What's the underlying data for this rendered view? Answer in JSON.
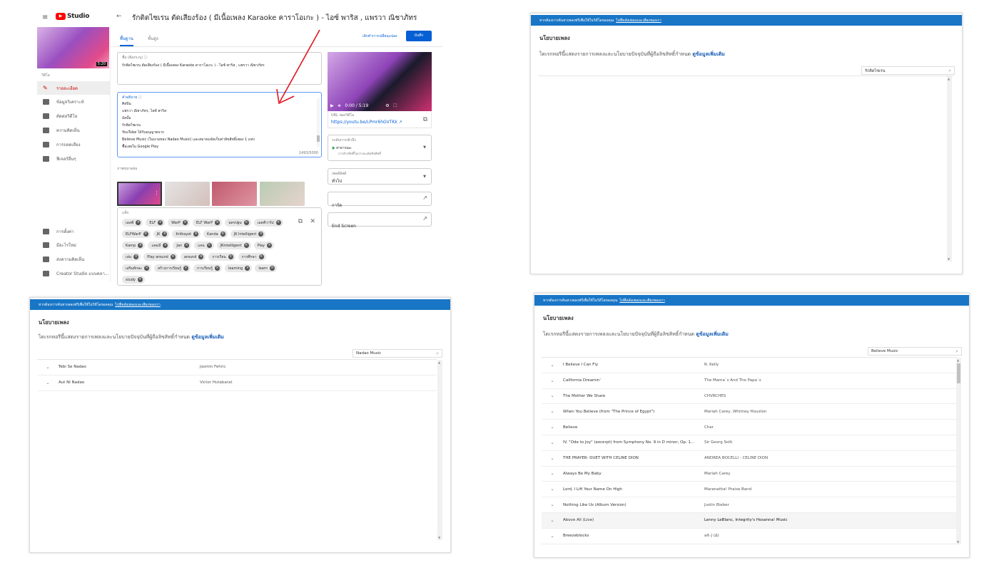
{
  "studio": {
    "logo": "Studio",
    "video_title": "รักติดไซเรน ตัดเสียงร้อง ( มีเนื้อเพลง Karaoke คาราโอเกะ ) - ไอซ์ พาริส , แพรวา ณิชาภัทร",
    "thumb_duration": "5:20",
    "sidebar_section": "วิดีโอ",
    "sidebar": [
      {
        "label": "รายละเอียด",
        "icon": "pencil-icon"
      },
      {
        "label": "ข้อมูลวิเคราะห์",
        "icon": "analytics-icon"
      },
      {
        "label": "ตัดต่อวิดีโอ",
        "icon": "editor-icon"
      },
      {
        "label": "ความคิดเห็น",
        "icon": "comments-icon"
      },
      {
        "label": "การถอดเสียง",
        "icon": "translate-icon"
      },
      {
        "label": "ฟีเจอร์อื่นๆ",
        "icon": "other-features-icon"
      }
    ],
    "sidebar_bottom": [
      {
        "label": "การตั้งค่า",
        "icon": "gear-icon"
      },
      {
        "label": "มีอะไรใหม่",
        "icon": "alert-icon"
      },
      {
        "label": "ส่งความคิดเห็น",
        "icon": "feedback-icon"
      },
      {
        "label": "Creator Studio แบบคลา...",
        "icon": "classic-studio-icon"
      }
    ],
    "tabs": [
      "พื้นฐาน",
      "ขั้นสูง"
    ],
    "undo_label": "เลิกทำการเปลี่ยนแปลง",
    "save_label": "บันทึก",
    "title_label": "ชื่อ (ต้องระบุ)",
    "title_value": "รักติดไซเรน ตัดเสียงร้อง ( มีเนื้อเพลง Karaoke คาราโอเกะ ) - ไอซ์ พาริส , แพรวา ณิชาภัทร",
    "desc_label": "คำอธิบาย",
    "desc_lines": [
      "ศิลปิน",
      "แพรวา ณิชาภัทร, ไอซ์ พาริส",
      "อัลบั้ม",
      "รักติดไซเรน",
      "YouTube ได้รับอนุญาตจาก",
      "Believe Music (ในนามของ Nadao Music) และสมาคมจัดเก็บค่าลิขสิทธิ์เพลง 1 แห่ง",
      "ซื้อเลยใน Google Play"
    ],
    "desc_count": "1493/5000",
    "thumbnails_label": "ภาพขนาดย่อ",
    "tags_label": "แท็ก",
    "tags": [
      "เอลฟ์",
      "ELF",
      "WarP",
      "ELF WarP",
      "นครปฐม",
      "เอลฟ์วาร์ป",
      "ELFWarP",
      "JK",
      "Krittayot",
      "Kanda",
      "JK Intelligent",
      "Kamp",
      "แคมป์",
      "Jan",
      "แจน",
      "JKintelligent",
      "Play",
      "เล่น",
      "Play around",
      "around",
      "การเรียน",
      "การศึกษา",
      "เสริมทักษะ",
      "สร้างการเรียนรู้",
      "การเรียนรู้",
      "learning",
      "learn",
      "study"
    ],
    "player_time": "0:00 / 5:19",
    "url_label": "URL ของวิดีโอ",
    "url": "https://youtu.be/LPmr6hGVTKk",
    "visibility_label": "ระดับการเข้าถึง",
    "visibility_value": "สาธารณะ",
    "visibility_sub": "การอ้างสิทธิ์ในการละเมิดลิขสิทธิ์",
    "playlist_label": "เพลย์ลิสต์",
    "playlist_value": "ทั่วไป",
    "cards_label": "การ์ด",
    "endscreen_label": "End Screen"
  },
  "music_common": {
    "banner_text": "หากต้องการค้นหาเพลงฟรีเพื่อใช้ในวิดีโอของคุณ",
    "banner_link": "ไปที่คลังเพลงและเสียงของเรา",
    "title": "นโยบายเพลง",
    "desc": "ไดเรกทอรีนี้แสดงรายการเพลงและนโยบายปัจจุบันที่ผู้ถือลิขสิทธิ์กำหนด",
    "learn_more": "ดูข้อมูลเพิ่มเติม"
  },
  "music1": {
    "search": "รักติดไซเรน"
  },
  "music2": {
    "search": "Nadao Music",
    "rows": [
      {
        "song": "Tebi Se Nadao",
        "artist": "Jasmin Fehric"
      },
      {
        "song": "Aut Ni Nadao",
        "artist": "Victor Hutabarat"
      }
    ]
  },
  "music3": {
    "search": "Believe Music",
    "rows": [
      {
        "song": "I Believe I Can Fly",
        "artist": "R. Kelly"
      },
      {
        "song": "California Dreamin'",
        "artist": "The Mama`s And The Papa`s"
      },
      {
        "song": "The Mother We Share",
        "artist": "CHVRCHES"
      },
      {
        "song": "When You Believe (from \"The Prince of Egypt\")",
        "artist": "Mariah Carey, Whitney Houston"
      },
      {
        "song": "Believe",
        "artist": "Cher"
      },
      {
        "song": "IV. \"Ode to Joy\" (excerpt) from Symphony No. 9 in D minor, Op. 1...",
        "artist": "Sir Georg Solti"
      },
      {
        "song": "THE PRAYER- DUET WITH CELINE DION",
        "artist": "ANDREA BOCELLI - CELINE DION"
      },
      {
        "song": "Always Be My Baby",
        "artist": "Mariah Carey"
      },
      {
        "song": "Lord, I Lift Your Name On High",
        "artist": "Maranatha! Praise Band"
      },
      {
        "song": "Nothing Like Us (Album Version)",
        "artist": "Justin Bieber"
      },
      {
        "song": "Above All (Live)",
        "artist": "Lenny LeBlanc, Integrity's Hosanna! Music"
      },
      {
        "song": "Breezeblocks",
        "artist": "alt-J (∆)"
      }
    ]
  },
  "colors": {
    "accent": "#065fd4",
    "youtube_red": "#ff0000",
    "banner": "#1976c6",
    "annotation_arrow": "#e0141e"
  }
}
